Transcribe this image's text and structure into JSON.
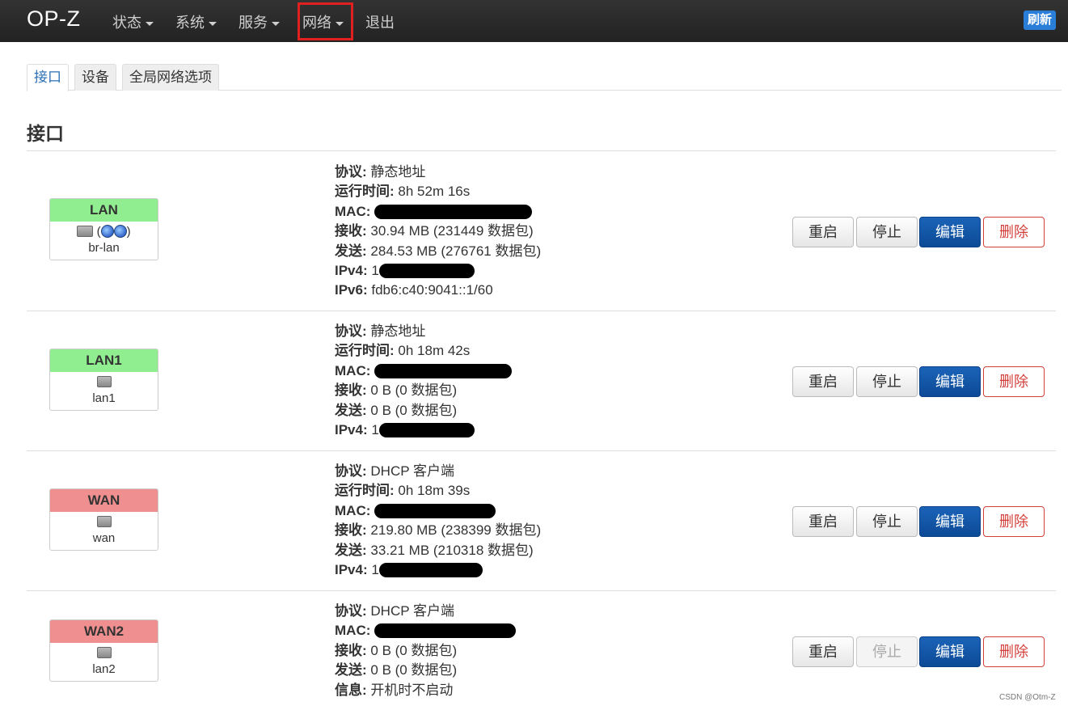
{
  "navbar": {
    "brand": "OP-Z",
    "items": [
      {
        "label": "状态",
        "caret": true
      },
      {
        "label": "系统",
        "caret": true
      },
      {
        "label": "服务",
        "caret": true
      },
      {
        "label": "网络",
        "caret": true
      },
      {
        "label": "退出",
        "caret": false
      }
    ],
    "refresh_label": "刷新"
  },
  "tabs": [
    {
      "label": "接口",
      "active": true
    },
    {
      "label": "设备",
      "active": false
    },
    {
      "label": "全局网络选项",
      "active": false
    }
  ],
  "section_title": "接口",
  "interfaces": [
    {
      "name": "LAN",
      "status_color": "#90ee90",
      "icons": [
        "bridge-icon",
        "globe-icon",
        "globe-icon"
      ],
      "device": "br-lan",
      "info": [
        {
          "k": "协议:",
          "v": "静态地址"
        },
        {
          "k": "运行时间:",
          "v": "8h 52m 16s"
        },
        {
          "k": "MAC:",
          "v": ""
        },
        {
          "k": "接收:",
          "v": "30.94 MB (231449 数据包)"
        },
        {
          "k": "发送:",
          "v": "284.53 MB (276761 数据包)"
        },
        {
          "k": "IPv4:",
          "v": "1"
        },
        {
          "k": "IPv6:",
          "v": "fdb6:c40:9041::1/60"
        }
      ],
      "buttons": {
        "restart": "重启",
        "stop": "停止",
        "edit": "编辑",
        "delete": "删除"
      }
    },
    {
      "name": "LAN1",
      "status_color": "#90ee90",
      "icons": [
        "ethernet-port-icon"
      ],
      "device": "lan1",
      "info": [
        {
          "k": "协议:",
          "v": "静态地址"
        },
        {
          "k": "运行时间:",
          "v": "0h 18m 42s"
        },
        {
          "k": "MAC:",
          "v": ""
        },
        {
          "k": "接收:",
          "v": "0 B (0 数据包)"
        },
        {
          "k": "发送:",
          "v": "0 B (0 数据包)"
        },
        {
          "k": "IPv4:",
          "v": "1"
        }
      ],
      "buttons": {
        "restart": "重启",
        "stop": "停止",
        "edit": "编辑",
        "delete": "删除"
      }
    },
    {
      "name": "WAN",
      "status_color": "#f08f8f",
      "icons": [
        "ethernet-port-icon"
      ],
      "device": "wan",
      "info": [
        {
          "k": "协议:",
          "v": "DHCP 客户端"
        },
        {
          "k": "运行时间:",
          "v": "0h 18m 39s"
        },
        {
          "k": "MAC:",
          "v": ""
        },
        {
          "k": "接收:",
          "v": "219.80 MB (238399 数据包)"
        },
        {
          "k": "发送:",
          "v": "33.21 MB (210318 数据包)"
        },
        {
          "k": "IPv4:",
          "v": "1"
        }
      ],
      "buttons": {
        "restart": "重启",
        "stop": "停止",
        "edit": "编辑",
        "delete": "删除"
      }
    },
    {
      "name": "WAN2",
      "status_color": "#f08f8f",
      "icons": [
        "ethernet-port-icon"
      ],
      "device": "lan2",
      "info": [
        {
          "k": "协议:",
          "v": "DHCP 客户端"
        },
        {
          "k": "MAC:",
          "v": ""
        },
        {
          "k": "接收:",
          "v": "0 B (0 数据包)"
        },
        {
          "k": "发送:",
          "v": "0 B (0 数据包)"
        },
        {
          "k": "信息:",
          "v": "开机时不启动"
        }
      ],
      "buttons": {
        "restart": "重启",
        "stop": "停止",
        "edit": "编辑",
        "delete": "删除"
      }
    }
  ],
  "watermark": "CSDN @Otm-Z"
}
